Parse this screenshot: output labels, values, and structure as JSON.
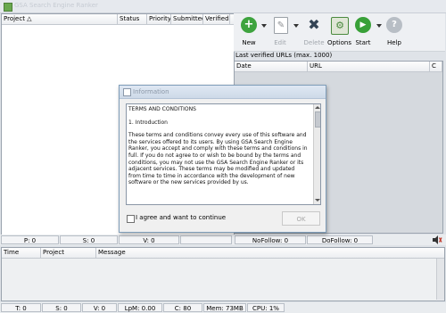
{
  "window": {
    "title": "GSA Search Engine Ranker",
    "title_color": "#c6cbd3"
  },
  "project_table": {
    "columns": [
      "Project △",
      "Status",
      "Priority",
      "Submitted",
      "Verified"
    ]
  },
  "toolbar": {
    "buttons": [
      {
        "label": "New",
        "icon": "plus-icon",
        "color": "#3ea33e",
        "enabled": true
      },
      {
        "label": "Edit",
        "icon": "edit-icon",
        "color": "#8c8f93",
        "enabled": false
      },
      {
        "label": "Delete",
        "icon": "delete-icon",
        "color": "#334455",
        "enabled": false
      },
      {
        "label": "Options",
        "icon": "options-icon",
        "color": "#4a8a3e",
        "enabled": true
      },
      {
        "label": "Start",
        "icon": "start-icon",
        "color": "#38a038",
        "enabled": true
      },
      {
        "label": "Help",
        "icon": "help-icon",
        "color": "#9aa0a6",
        "enabled": true
      }
    ]
  },
  "verified_urls": {
    "caption": "Last verified URLs (max. 1000)",
    "columns": [
      "Date",
      "URL",
      "C"
    ]
  },
  "status_top": {
    "p": "P: 0",
    "s": "S: 0",
    "v": "V: 0",
    "nofollow": "NoFollow: 0",
    "dofollow": "DoFollow: 0"
  },
  "log_table": {
    "columns": [
      "Time",
      "Project",
      "Message"
    ]
  },
  "status_bottom": {
    "t": "T: 0",
    "s": "S: 0",
    "v": "V: 0",
    "lpm": "LpM: 0.00",
    "c": "C: 80",
    "mem": "Mem: 73MB",
    "cpu": "CPU: 1%"
  },
  "dialog": {
    "title": "Information",
    "terms_heading": "TERMS AND CONDITIONS",
    "section": "1. Introduction",
    "paragraph1": "These terms and conditions convey every use of this software and the services offered to its users. By using GSA Search Engine Ranker, you accept and comply with these terms and conditions in full. If you do not agree to or wish to be bound by the terms and conditions, you may not use the GSA Search Engine Ranker or its adjacent services. These terms may be modified and updated from time to time in accordance with the development of new software or the new services provided by us.",
    "agree_label": "I agree and want to continue",
    "agree_checked": false,
    "ok_label": "OK"
  }
}
